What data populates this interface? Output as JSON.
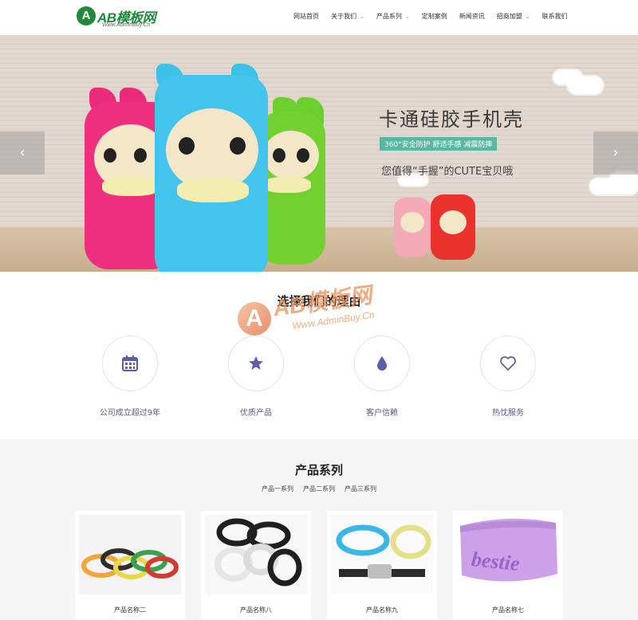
{
  "header": {
    "logo_letter": "A",
    "logo_text": "AB模板网",
    "logo_sub": "Www.AdminBuy.Cn",
    "nav": [
      {
        "label": "网站首页",
        "dropdown": false
      },
      {
        "label": "关于我们",
        "dropdown": true
      },
      {
        "label": "产品系列",
        "dropdown": true
      },
      {
        "label": "定制案例",
        "dropdown": false
      },
      {
        "label": "新闻资讯",
        "dropdown": false
      },
      {
        "label": "招商加盟",
        "dropdown": true
      },
      {
        "label": "联系我们",
        "dropdown": false
      }
    ]
  },
  "banner": {
    "title": "卡通硅胶手机壳",
    "tag": "360°安全防护 舒适手感 减震防摔",
    "subtitle": "您值得“手握”的CUTE宝贝哦",
    "prev_icon": "‹",
    "next_icon": "›"
  },
  "why": {
    "title": "选择我们的理由",
    "watermark_letter": "A",
    "watermark_text": "AB模板网",
    "watermark_sub": "Www.AdminBuy.Cn",
    "features": [
      {
        "label": "公司成立超过9年",
        "icon": "calendar-icon"
      },
      {
        "label": "优质产品",
        "icon": "star-icon"
      },
      {
        "label": "客户信赖",
        "icon": "drop-icon"
      },
      {
        "label": "热忱服务",
        "icon": "heart-icon"
      }
    ]
  },
  "products": {
    "title": "产品系列",
    "tabs": [
      "产品一系列",
      "产品二系列",
      "产品三系列"
    ],
    "items": [
      {
        "label": "产品名称二"
      },
      {
        "label": "产品名称八"
      },
      {
        "label": "产品名称九"
      },
      {
        "label": "产品名称七",
        "image_text": "bestie"
      }
    ]
  },
  "colors": {
    "brand_green": "#1f8a3a",
    "icon_accent": "#5b5fa8",
    "tag_bg": "#57b8a3"
  }
}
